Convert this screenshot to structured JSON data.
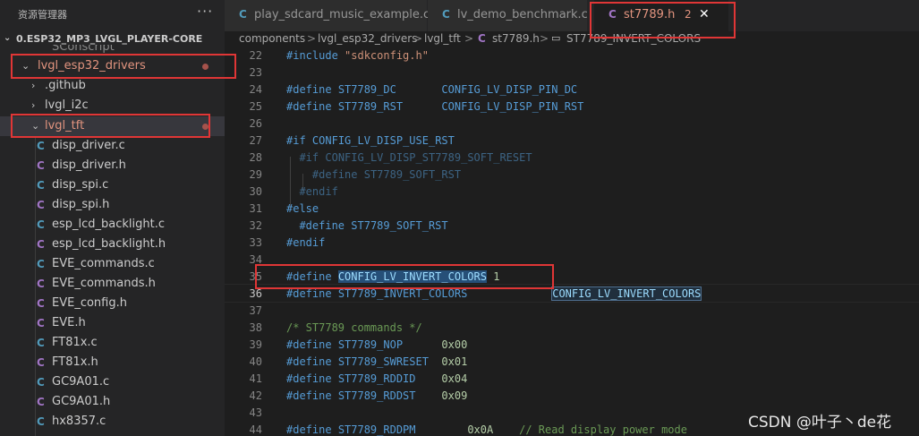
{
  "sidebar": {
    "title": "资源管理器",
    "more_icon": "ellipsis-icon",
    "project": "0.ESP32_MP3_LVGL_PLAYER-CORE",
    "clipped_item": "SConscript",
    "items": [
      {
        "label": "lvgl_esp32_drivers",
        "type": "folder",
        "expanded": true
      },
      {
        "label": ".github",
        "type": "folder",
        "expanded": false
      },
      {
        "label": "lvgl_i2c",
        "type": "folder",
        "expanded": false
      },
      {
        "label": "lvgl_tft",
        "type": "folder",
        "expanded": true
      },
      {
        "label": "disp_driver.c",
        "type": "c"
      },
      {
        "label": "disp_driver.h",
        "type": "h"
      },
      {
        "label": "disp_spi.c",
        "type": "c"
      },
      {
        "label": "disp_spi.h",
        "type": "h"
      },
      {
        "label": "esp_lcd_backlight.c",
        "type": "c"
      },
      {
        "label": "esp_lcd_backlight.h",
        "type": "h"
      },
      {
        "label": "EVE_commands.c",
        "type": "c"
      },
      {
        "label": "EVE_commands.h",
        "type": "h"
      },
      {
        "label": "EVE_config.h",
        "type": "h"
      },
      {
        "label": "EVE.h",
        "type": "h"
      },
      {
        "label": "FT81x.c",
        "type": "c"
      },
      {
        "label": "FT81x.h",
        "type": "h"
      },
      {
        "label": "GC9A01.c",
        "type": "c"
      },
      {
        "label": "GC9A01.h",
        "type": "h"
      },
      {
        "label": "hx8357.c",
        "type": "c"
      }
    ]
  },
  "file_icon_letter": "C",
  "tabs": [
    {
      "label": "play_sdcard_music_example.c",
      "type": "c",
      "active": false
    },
    {
      "label": "lv_demo_benchmark.c",
      "type": "c",
      "active": false
    },
    {
      "label": "st7789.h",
      "type": "h",
      "active": true,
      "problems": "2",
      "close": "✕"
    }
  ],
  "breadcrumb": {
    "parts": [
      "components",
      "lvgl_esp32_drivers",
      "lvgl_tft",
      "st7789.h"
    ],
    "symbol": "ST7789_INVERT_COLORS",
    "sep": ">"
  },
  "editor": {
    "line_numbers": [
      "22",
      "23",
      "24",
      "25",
      "26",
      "27",
      "28",
      "29",
      "30",
      "31",
      "32",
      "33",
      "34",
      "35",
      "36",
      "37",
      "38",
      "39",
      "40",
      "41",
      "42",
      "43",
      "44"
    ],
    "current_line": "36"
  },
  "code": {
    "l22": "#include",
    "l22s": "\"sdkconfig.h\"",
    "l24a": "#define",
    "l24b": "ST7789_DC",
    "l24c": "CONFIG_LV_DISP_PIN_DC",
    "l25a": "#define",
    "l25b": "ST7789_RST",
    "l25c": "CONFIG_LV_DISP_PIN_RST",
    "l27a": "#if",
    "l27b": "CONFIG_LV_DISP_USE_RST",
    "l28a": "#if",
    "l28b": "CONFIG_LV_DISP_ST7789_SOFT_RESET",
    "l29a": "#define",
    "l29b": "ST7789_SOFT_RST",
    "l30": "#endif",
    "l31": "#else",
    "l32a": "#define",
    "l32b": "ST7789_SOFT_RST",
    "l33": "#endif",
    "l35a": "#define",
    "l35b": "CONFIG_LV_INVERT_COLORS",
    "l35c": "1",
    "l36a": "#define",
    "l36b": "ST7789_INVERT_COLORS",
    "l36c": "CONFIG_LV_INVERT_COLORS",
    "l38": "/* ST7789 commands */",
    "l39a": "#define",
    "l39b": "ST7789_NOP",
    "l39c": "0x00",
    "l40a": "#define",
    "l40b": "ST7789_SWRESET",
    "l40c": "0x01",
    "l41a": "#define",
    "l41b": "ST7789_RDDID",
    "l41c": "0x04",
    "l42a": "#define",
    "l42b": "ST7789_RDDST",
    "l42c": "0x09",
    "l44a": "#define",
    "l44b": "ST7789_RDDPM",
    "l44c": "0x0A",
    "l44d": "// Read display power mode"
  },
  "watermark": "CSDN @叶子丶de花",
  "colors": {
    "accent_red_box": "#e03636",
    "modified_text": "#e2947f",
    "c_icon": "#519aba",
    "h_icon": "#a074c4"
  }
}
